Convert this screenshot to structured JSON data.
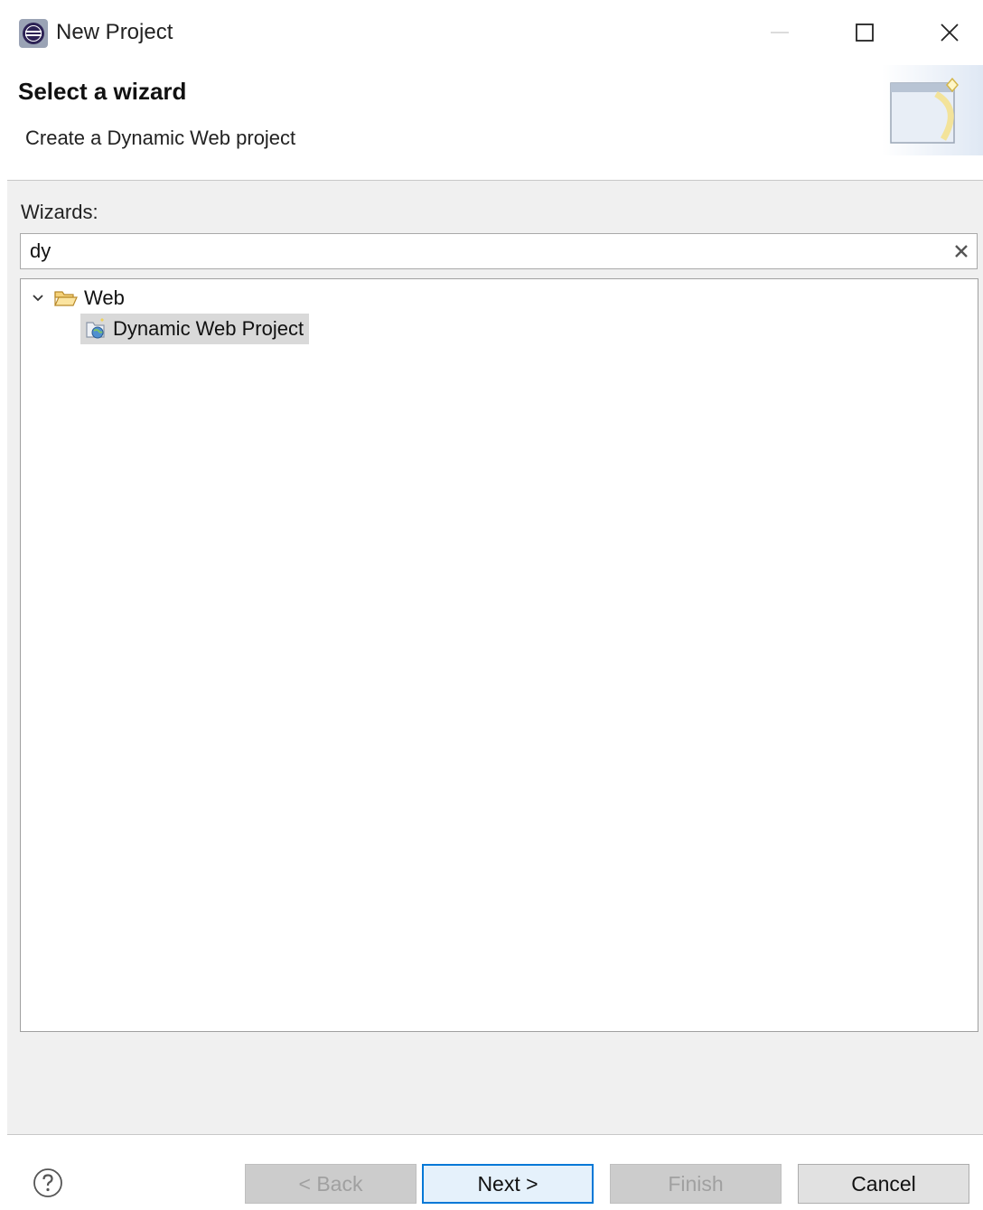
{
  "window": {
    "title": "New Project",
    "icon": "eclipse-icon"
  },
  "header": {
    "title": "Select a wizard",
    "description": "Create a Dynamic Web project",
    "banner_icon": "new-wizard-banner-icon"
  },
  "wizards": {
    "label": "Wizards:",
    "filter_value": "dy",
    "clear_icon": "clear-icon",
    "tree": [
      {
        "label": "Web",
        "expanded": true,
        "icon": "folder-open-icon",
        "children": [
          {
            "label": "Dynamic Web Project",
            "selected": true,
            "icon": "dynamic-web-project-icon"
          }
        ]
      }
    ]
  },
  "buttons": {
    "back": "< Back",
    "next": "Next >",
    "finish": "Finish",
    "cancel": "Cancel",
    "help_icon": "help-icon"
  },
  "colors": {
    "accent": "#0078d7",
    "selection": "#d9d9d9",
    "panel_bg": "#f0f0f0"
  }
}
